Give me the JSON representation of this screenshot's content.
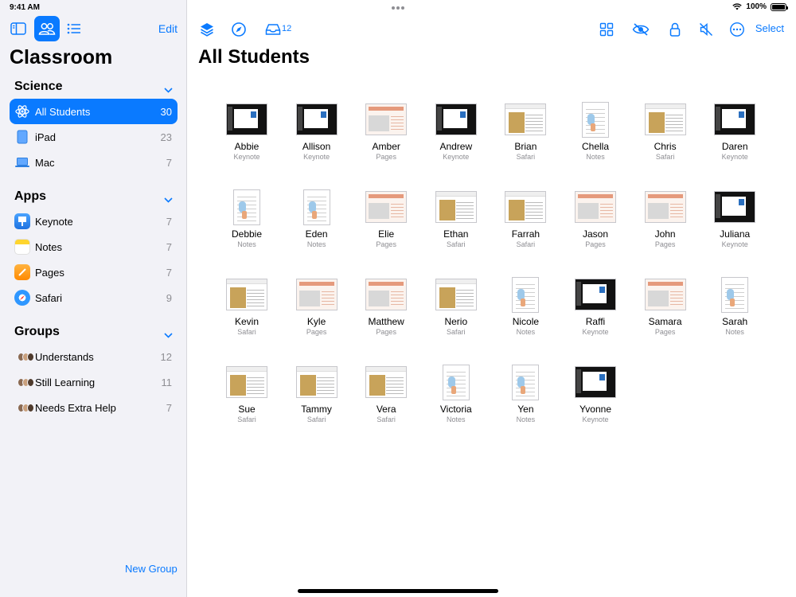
{
  "status": {
    "time": "9:41 AM",
    "battery": "100%"
  },
  "sidebar": {
    "edit_label": "Edit",
    "title": "Classroom",
    "sections": [
      {
        "title": "Science",
        "items": [
          {
            "label": "All Students",
            "count": "30",
            "icon": "atom-icon",
            "selected": true
          },
          {
            "label": "iPad",
            "count": "23",
            "icon": "ipad-icon"
          },
          {
            "label": "Mac",
            "count": "7",
            "icon": "laptop-icon"
          }
        ]
      },
      {
        "title": "Apps",
        "items": [
          {
            "label": "Keynote",
            "count": "7",
            "icon": "keynote-app-icon",
            "color": "#2d8cf0"
          },
          {
            "label": "Notes",
            "count": "7",
            "icon": "notes-app-icon",
            "color": "#ffd52e"
          },
          {
            "label": "Pages",
            "count": "7",
            "icon": "pages-app-icon",
            "color": "#ff9f0a"
          },
          {
            "label": "Safari",
            "count": "9",
            "icon": "safari-app-icon",
            "color": "#1e90ff"
          }
        ]
      },
      {
        "title": "Groups",
        "items": [
          {
            "label": "Understands",
            "count": "12",
            "icon": "group-avatars-icon"
          },
          {
            "label": "Still Learning",
            "count": "11",
            "icon": "group-avatars-icon"
          },
          {
            "label": "Needs Extra Help",
            "count": "7",
            "icon": "group-avatars-icon"
          }
        ]
      }
    ],
    "new_group_label": "New Group"
  },
  "main": {
    "title": "All Students",
    "inbox_count": "12",
    "select_label": "Select",
    "accent": "#0a7aff",
    "students": [
      {
        "name": "Abbie",
        "app": "Keynote"
      },
      {
        "name": "Allison",
        "app": "Keynote"
      },
      {
        "name": "Amber",
        "app": "Pages"
      },
      {
        "name": "Andrew",
        "app": "Keynote"
      },
      {
        "name": "Brian",
        "app": "Safari"
      },
      {
        "name": "Chella",
        "app": "Notes"
      },
      {
        "name": "Chris",
        "app": "Safari"
      },
      {
        "name": "Daren",
        "app": "Keynote"
      },
      {
        "name": "Debbie",
        "app": "Notes"
      },
      {
        "name": "Eden",
        "app": "Notes"
      },
      {
        "name": "Elie",
        "app": "Pages"
      },
      {
        "name": "Ethan",
        "app": "Safari"
      },
      {
        "name": "Farrah",
        "app": "Safari"
      },
      {
        "name": "Jason",
        "app": "Pages"
      },
      {
        "name": "John",
        "app": "Pages"
      },
      {
        "name": "Juliana",
        "app": "Keynote"
      },
      {
        "name": "Kevin",
        "app": "Safari"
      },
      {
        "name": "Kyle",
        "app": "Pages"
      },
      {
        "name": "Matthew",
        "app": "Pages"
      },
      {
        "name": "Nerio",
        "app": "Safari"
      },
      {
        "name": "Nicole",
        "app": "Notes"
      },
      {
        "name": "Raffi",
        "app": "Keynote"
      },
      {
        "name": "Samara",
        "app": "Pages"
      },
      {
        "name": "Sarah",
        "app": "Notes"
      },
      {
        "name": "Sue",
        "app": "Safari"
      },
      {
        "name": "Tammy",
        "app": "Safari"
      },
      {
        "name": "Vera",
        "app": "Safari"
      },
      {
        "name": "Victoria",
        "app": "Notes"
      },
      {
        "name": "Yen",
        "app": "Notes"
      },
      {
        "name": "Yvonne",
        "app": "Keynote"
      }
    ]
  }
}
